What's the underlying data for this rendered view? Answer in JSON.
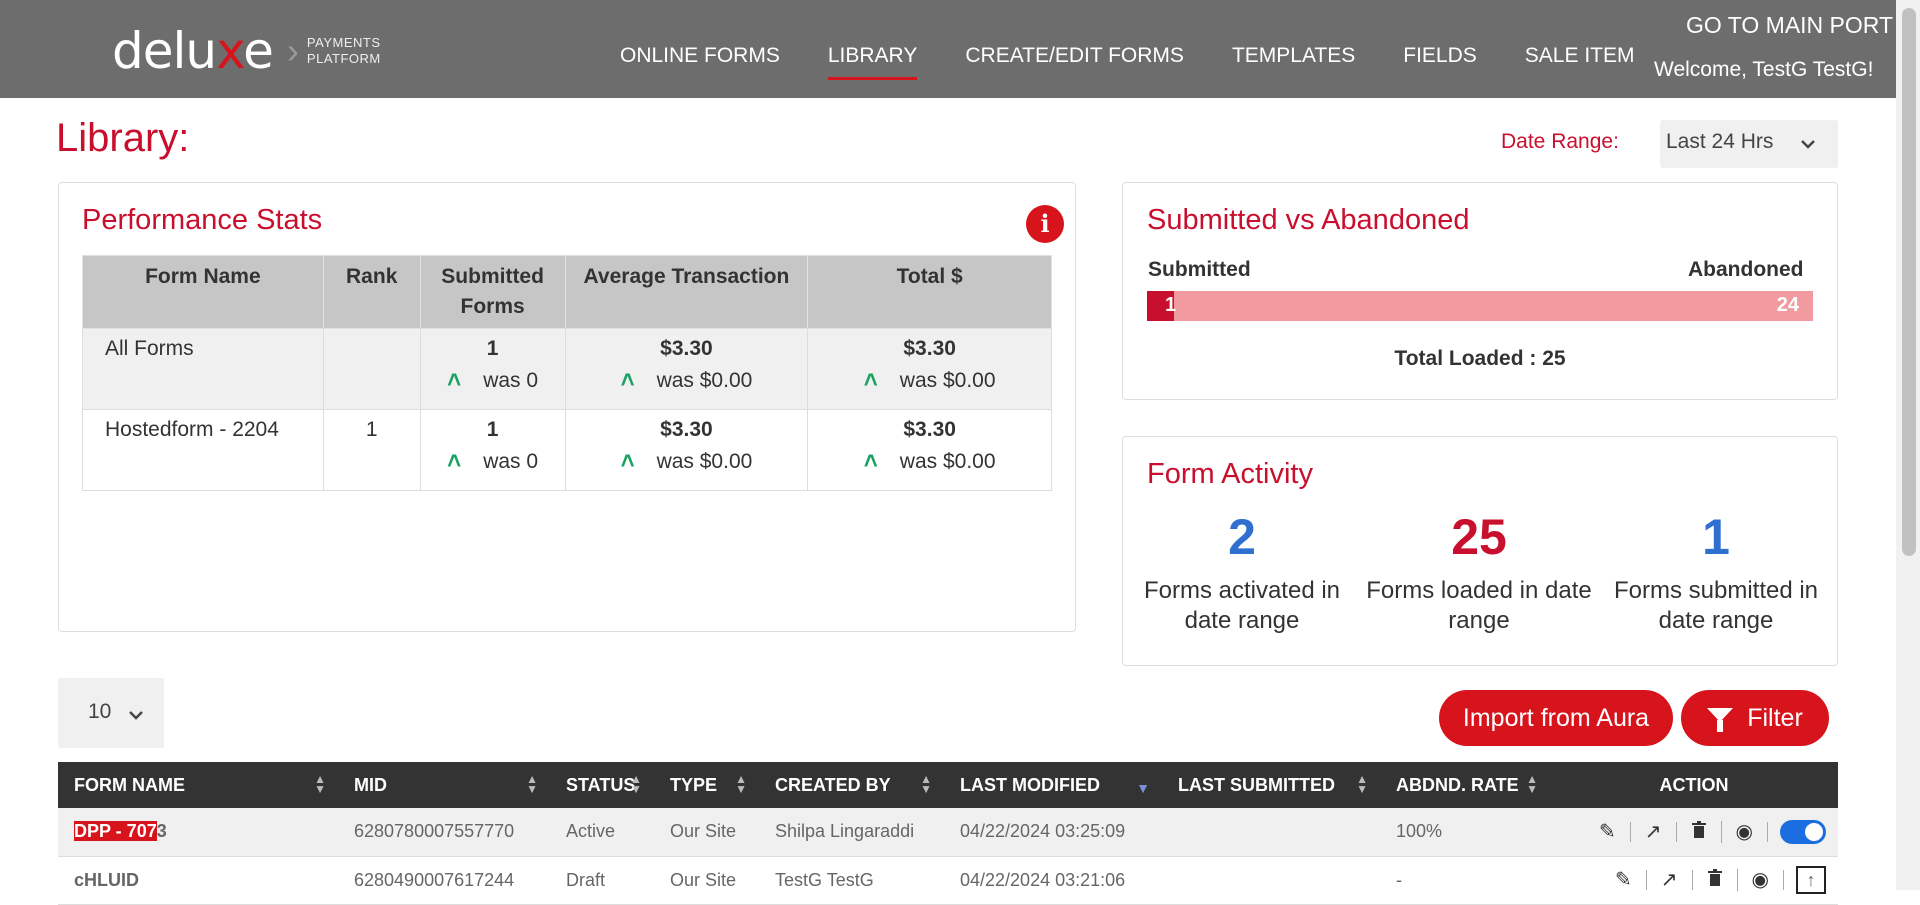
{
  "brand": {
    "word_pre": "delu",
    "word_x": "x",
    "word_post": "e",
    "sub_line1": "PAYMENTS",
    "sub_line2": "PLATFORM"
  },
  "nav": {
    "items": [
      "ONLINE FORMS",
      "LIBRARY",
      "CREATE/EDIT FORMS",
      "TEMPLATES",
      "FIELDS",
      "SALE ITEM"
    ],
    "active": "LIBRARY"
  },
  "header": {
    "go_main": "GO TO MAIN PORT",
    "welcome": "Welcome, TestG TestG!"
  },
  "page": {
    "title": "Library:",
    "date_range_label": "Date Range:",
    "date_range_value": "Last 24 Hrs"
  },
  "performance": {
    "title": "Performance Stats",
    "headers": [
      "Form Name",
      "Rank",
      "Submitted Forms",
      "Average Transaction",
      "Total $"
    ],
    "rows": [
      {
        "name": "All Forms",
        "rank": "",
        "submitted": "1",
        "submitted_was": "was 0",
        "avg": "$3.30",
        "avg_was": "was $0.00",
        "total": "$3.30",
        "total_was": "was $0.00"
      },
      {
        "name": "Hostedform - 2204",
        "rank": "1",
        "submitted": "1",
        "submitted_was": "was 0",
        "avg": "$3.30",
        "avg_was": "was $0.00",
        "total": "$3.30",
        "total_was": "was $0.00"
      }
    ]
  },
  "submitted_vs_abandoned": {
    "title": "Submitted vs Abandoned",
    "submitted_label": "Submitted",
    "abandoned_label": "Abandoned",
    "submitted": 1,
    "abandoned": 24,
    "submitted_text": "1",
    "abandoned_text": "24",
    "total_loaded": "Total Loaded : 25"
  },
  "form_activity": {
    "title": "Form Activity",
    "stats": [
      {
        "value": "2",
        "label": "Forms activated in date range",
        "color": "#2f6fd0"
      },
      {
        "value": "25",
        "label": "Forms loaded in date range",
        "color": "#c8102e"
      },
      {
        "value": "1",
        "label": "Forms submitted in date range",
        "color": "#2f6fd0"
      }
    ]
  },
  "list": {
    "page_size": "10",
    "import_button": "Import from Aura",
    "filter_button": "Filter",
    "columns": [
      "FORM NAME",
      "MID",
      "STATUS",
      "TYPE",
      "CREATED BY",
      "LAST MODIFIED",
      "LAST SUBMITTED",
      "ABDND. RATE",
      "ACTION"
    ],
    "rows": [
      {
        "name_hl": "DPP - 707",
        "name_rest": "3",
        "mid": "6280780007557770",
        "status": "Active",
        "type": "Our Site",
        "created_by": "Shilpa Lingaraddi",
        "last_modified": "04/22/2024 03:25:09",
        "last_submitted": "",
        "abandon_rate": "100%"
      },
      {
        "name_hl": "",
        "name_rest": "cHLUID",
        "mid": "6280490007617244",
        "status": "Draft",
        "type": "Our Site",
        "created_by": "TestG TestG",
        "last_modified": "04/22/2024 03:21:06",
        "last_submitted": "",
        "abandon_rate": "-"
      }
    ]
  },
  "colors": {
    "brand_red": "#c8102e",
    "header_bg": "#6d6d6d",
    "stat_blue": "#2f6fd0",
    "arrow_green": "#1aa260"
  }
}
